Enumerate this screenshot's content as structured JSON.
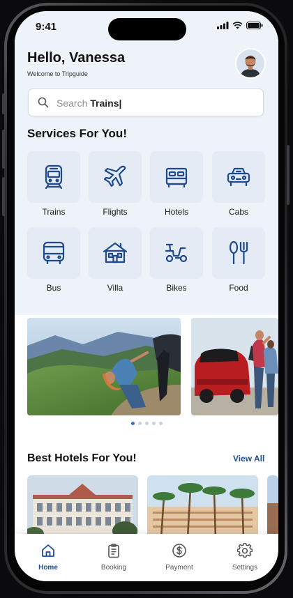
{
  "status_bar": {
    "time": "9:41"
  },
  "header": {
    "greeting": "Hello, Vanessa",
    "subtitle": "Welcome to Tripguide"
  },
  "search": {
    "prefix": "Search ",
    "query": "Trains|"
  },
  "services": {
    "title": "Services For You!",
    "items": [
      {
        "label": "Trains",
        "icon": "train-icon"
      },
      {
        "label": "Flights",
        "icon": "plane-icon"
      },
      {
        "label": "Hotels",
        "icon": "bed-icon"
      },
      {
        "label": "Cabs",
        "icon": "car-icon"
      },
      {
        "label": "Bus",
        "icon": "bus-icon"
      },
      {
        "label": "Villa",
        "icon": "house-icon"
      },
      {
        "label": "Bikes",
        "icon": "scooter-icon"
      },
      {
        "label": "Food",
        "icon": "fork-spoon-icon"
      }
    ]
  },
  "carousel": {
    "slides": 5,
    "active_index": 0
  },
  "hotels": {
    "title": "Best Hotels For You!",
    "view_all": "View All"
  },
  "tabbar": {
    "items": [
      {
        "label": "Home",
        "icon": "home-icon",
        "active": true
      },
      {
        "label": "Booking",
        "icon": "clipboard-icon",
        "active": false
      },
      {
        "label": "Payment",
        "icon": "dollar-circle-icon",
        "active": false
      },
      {
        "label": "Settings",
        "icon": "gear-icon",
        "active": false
      }
    ]
  },
  "colors": {
    "accent": "#1f4f96",
    "icon_blue": "#1e4a8c",
    "tile_bg": "#e4ebf5",
    "header_bg": "#eef2f9"
  }
}
